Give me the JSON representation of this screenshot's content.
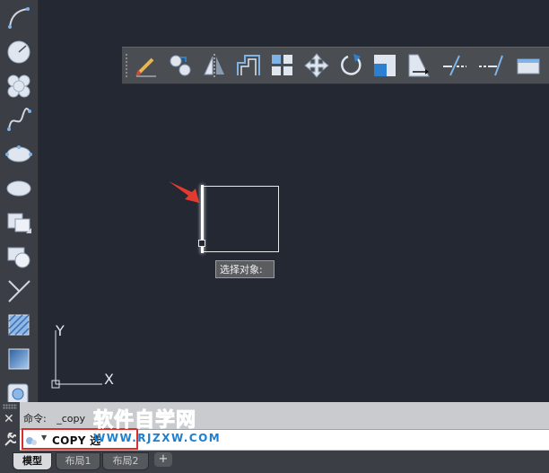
{
  "toolbars": {
    "left_tools": [
      "arc-icon",
      "circle-icon",
      "revision-cloud-icon",
      "spline-icon",
      "ellipse-icon",
      "ellipse-arc-icon",
      "insert-block-icon",
      "make-block-icon",
      "line-icon",
      "hatch-icon",
      "gradient-icon",
      "region-icon"
    ],
    "modify_tools": [
      "erase-icon",
      "copy-icon",
      "mirror-icon",
      "offset-icon",
      "array-icon",
      "move-icon",
      "rotate-icon",
      "scale-icon",
      "stretch-icon",
      "trim-icon",
      "extend-icon",
      "break-icon"
    ]
  },
  "canvas": {
    "tooltip": "选择对象:",
    "ucs": {
      "y_label": "Y",
      "x_label": "X"
    }
  },
  "command": {
    "history_prompt": "命令:",
    "history_value": "_copy",
    "input_text": "COPY 选",
    "close_symbol": "✕"
  },
  "watermark": {
    "chinese": "软件自学网",
    "url": "WWW.RJZXW.COM"
  },
  "tabs": {
    "items": [
      "模型",
      "布局1",
      "布局2"
    ],
    "active": "模型",
    "add_symbol": "+"
  },
  "colors": {
    "canvas_bg": "#232833",
    "highlight_red": "#d9302c",
    "watermark_blue": "#1d7fd0"
  }
}
